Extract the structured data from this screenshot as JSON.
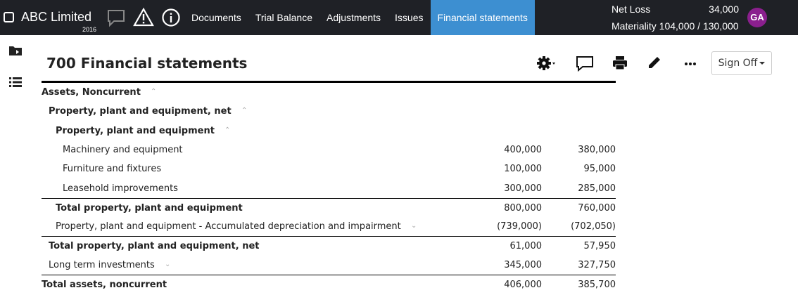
{
  "app": {
    "company": "ABC Limited",
    "year": "2016"
  },
  "nav": {
    "items": [
      {
        "label": "Documents"
      },
      {
        "label": "Trial Balance"
      },
      {
        "label": "Adjustments"
      },
      {
        "label": "Issues"
      },
      {
        "label": "Financial statements"
      }
    ],
    "active": "Financial statements"
  },
  "summary": {
    "net_loss_label": "Net Loss",
    "net_loss_value": "34,000",
    "materiality": "Materiality 104,000 / 130,000"
  },
  "user": {
    "initials": "GA",
    "avatar_color": "#8a1f8d"
  },
  "colors": {
    "topbar": "#1f2126",
    "active_tab": "#3d8fd1"
  },
  "header": {
    "title": "700 Financial statements",
    "signoff_label": "Sign Off"
  },
  "icons": {
    "topbar": [
      "comment-icon",
      "warning-icon",
      "info-icon"
    ],
    "sidebar": [
      "folder-import-icon",
      "list-icon"
    ],
    "toolbar": [
      "gear-icon",
      "comment-icon",
      "print-icon",
      "pencil-icon",
      "more-icon"
    ]
  },
  "statement": {
    "rows": [
      {
        "label": "Assets, Noncurrent",
        "v1": "",
        "v2": "",
        "indent": 0,
        "bold": true,
        "chevron": "up",
        "rule": false
      },
      {
        "label": "Property, plant and equipment, net",
        "v1": "",
        "v2": "",
        "indent": 1,
        "bold": true,
        "chevron": "up",
        "rule": false
      },
      {
        "label": "Property, plant and equipment",
        "v1": "",
        "v2": "",
        "indent": 2,
        "bold": true,
        "chevron": "up",
        "rule": false
      },
      {
        "label": "Machinery and equipment",
        "v1": "400,000",
        "v2": "380,000",
        "indent": 3,
        "bold": false,
        "chevron": "",
        "rule": false
      },
      {
        "label": "Furniture and fixtures",
        "v1": "100,000",
        "v2": "95,000",
        "indent": 3,
        "bold": false,
        "chevron": "",
        "rule": false
      },
      {
        "label": "Leasehold improvements",
        "v1": "300,000",
        "v2": "285,000",
        "indent": 3,
        "bold": false,
        "chevron": "",
        "rule": false
      },
      {
        "label": "Total property, plant and equipment",
        "v1": "800,000",
        "v2": "760,000",
        "indent": 2,
        "bold": true,
        "chevron": "",
        "rule": true
      },
      {
        "label": "Property, plant and equipment - Accumulated depreciation and impairment",
        "v1": "(739,000)",
        "v2": "(702,050)",
        "indent": 2,
        "bold": false,
        "chevron": "down",
        "rule": false
      },
      {
        "label": "Total property, plant and equipment, net",
        "v1": "61,000",
        "v2": "57,950",
        "indent": 1,
        "bold": true,
        "chevron": "",
        "rule": true
      },
      {
        "label": "Long term investments",
        "v1": "345,000",
        "v2": "327,750",
        "indent": 1,
        "bold": false,
        "chevron": "down",
        "rule": false
      },
      {
        "label": "Total assets, noncurrent",
        "v1": "406,000",
        "v2": "385,700",
        "indent": 0,
        "bold": true,
        "chevron": "",
        "rule": true
      }
    ]
  }
}
